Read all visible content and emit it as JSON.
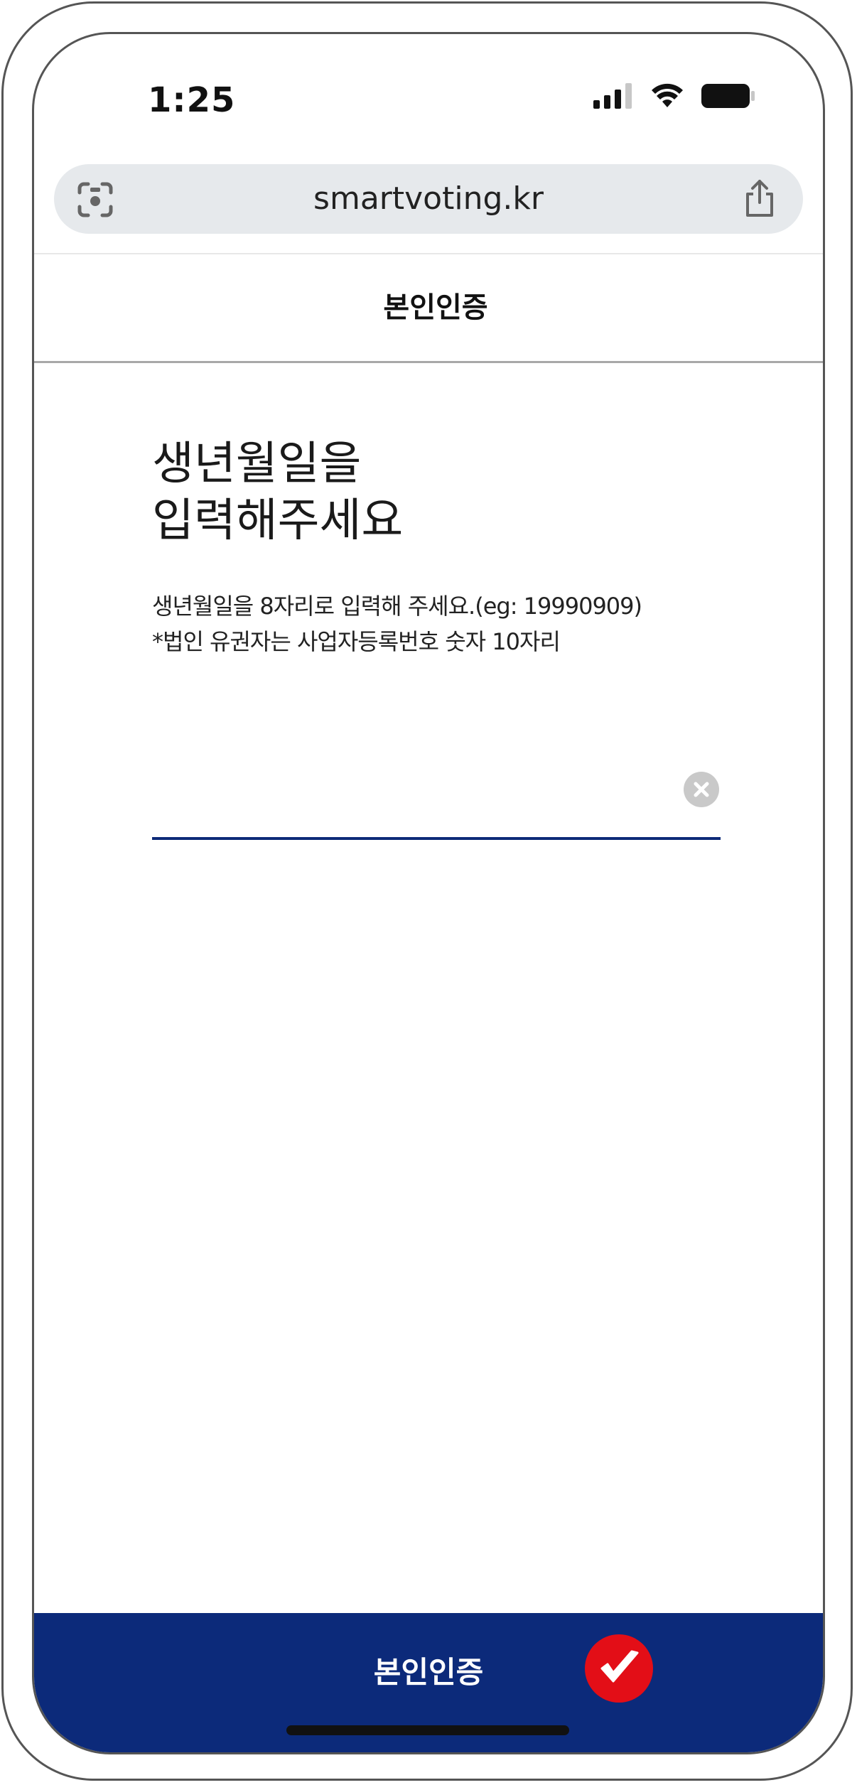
{
  "status_bar": {
    "time": "1:25"
  },
  "browser": {
    "url": "smartvoting.kr"
  },
  "header": {
    "title": "본인인증"
  },
  "content": {
    "heading_line1": "생년월일을",
    "heading_line2": "입력해주세요",
    "desc_line1": "생년월일을 8자리로 입력해 주세요.(eg: 19990909)",
    "desc_line2": "*법인 유권자는 사업자등록번호 숫자 10자리"
  },
  "input": {
    "value": "",
    "placeholder": ""
  },
  "footer": {
    "button_label": "본인인증"
  },
  "colors": {
    "primary": "#0c2a7a",
    "accent": "#e30e17",
    "url_bar": "#e6e9ec"
  }
}
